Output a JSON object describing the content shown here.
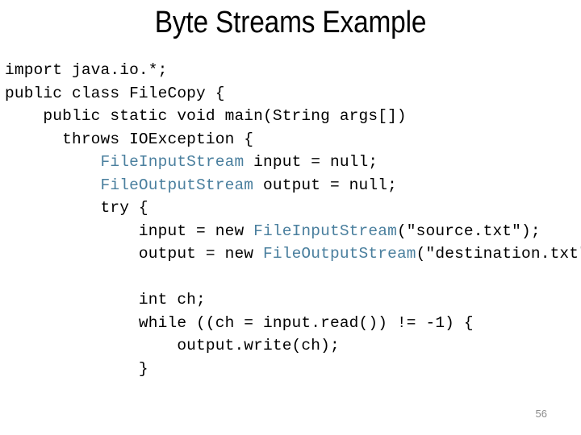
{
  "slide": {
    "title": "Byte Streams Example",
    "page_number": "56",
    "accent_color": "#4a7f9e",
    "text_color": "#000000",
    "background_color": "#ffffff",
    "page_number_color": "#8c8c8c"
  },
  "code": {
    "language": "java",
    "lines": [
      {
        "indent": 0,
        "parts": [
          {
            "t": "import java.io.*;",
            "c": "plain"
          }
        ]
      },
      {
        "indent": 0,
        "parts": [
          {
            "t": "public class FileCopy {",
            "c": "plain"
          }
        ]
      },
      {
        "indent": 2,
        "parts": [
          {
            "t": "public static void main(String args[])",
            "c": "plain"
          }
        ]
      },
      {
        "indent": 3,
        "parts": [
          {
            "t": "throws IOException {",
            "c": "plain"
          }
        ]
      },
      {
        "indent": 5,
        "parts": [
          {
            "t": "FileInputStream",
            "c": "cls"
          },
          {
            "t": " input = null;",
            "c": "plain"
          }
        ]
      },
      {
        "indent": 5,
        "parts": [
          {
            "t": "FileOutputStream",
            "c": "cls"
          },
          {
            "t": " output = null;",
            "c": "plain"
          }
        ]
      },
      {
        "indent": 5,
        "parts": [
          {
            "t": "try {",
            "c": "plain"
          }
        ]
      },
      {
        "indent": 7,
        "parts": [
          {
            "t": "input = new ",
            "c": "plain"
          },
          {
            "t": "FileInputStream",
            "c": "cls"
          },
          {
            "t": "(\"source.txt\");",
            "c": "plain"
          }
        ]
      },
      {
        "indent": 7,
        "parts": [
          {
            "t": "output = new ",
            "c": "plain"
          },
          {
            "t": "FileOutputStream",
            "c": "cls"
          },
          {
            "t": "(\"destination.txt\");",
            "c": "plain"
          }
        ]
      },
      {
        "indent": 0,
        "parts": [
          {
            "t": "",
            "c": "plain"
          }
        ]
      },
      {
        "indent": 7,
        "parts": [
          {
            "t": "int ch;",
            "c": "plain"
          }
        ]
      },
      {
        "indent": 7,
        "parts": [
          {
            "t": "while ((ch = input.read()) != -1) {",
            "c": "plain"
          }
        ]
      },
      {
        "indent": 9,
        "parts": [
          {
            "t": "output.write(ch);",
            "c": "plain"
          }
        ]
      },
      {
        "indent": 7,
        "parts": [
          {
            "t": "}",
            "c": "plain"
          }
        ]
      }
    ]
  }
}
